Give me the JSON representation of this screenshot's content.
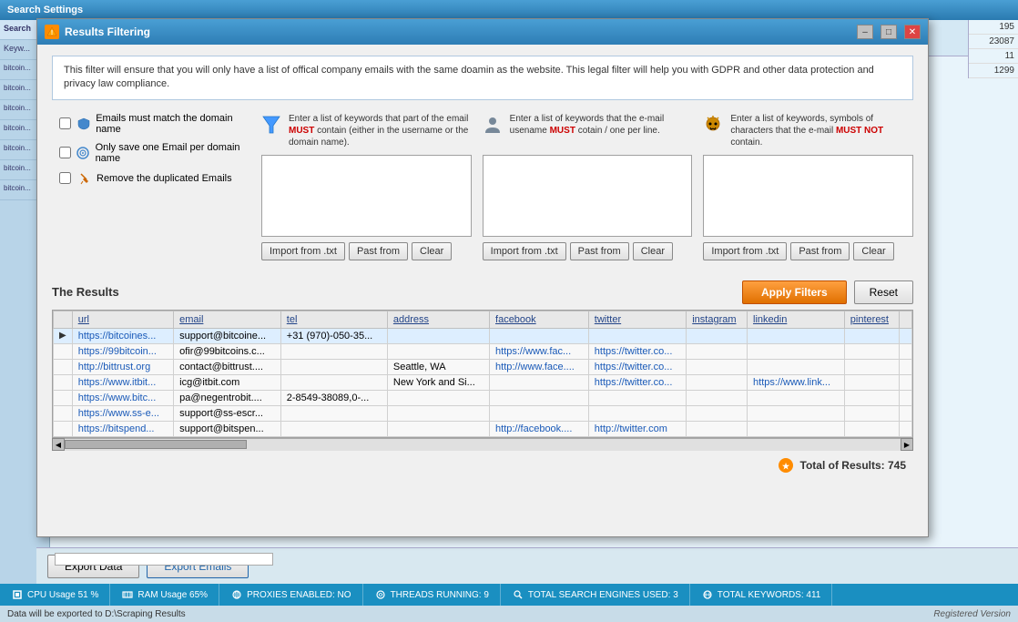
{
  "app": {
    "title": "Search Settings",
    "bg_title": "Search Settings"
  },
  "modal": {
    "title": "Results Filtering",
    "info_text": "This filter will ensure that you will only have a list of offical company emails with the same doamin as the website.  This legal filter will help you with GDPR and other data protection and privacy law compliance.",
    "checkboxes": [
      {
        "id": "cb1",
        "label": "Emails must match the domain name",
        "checked": false
      },
      {
        "id": "cb2",
        "label": "Only save one Email per domain name",
        "checked": false
      },
      {
        "id": "cb3",
        "label": "Remove the duplicated Emails",
        "checked": false
      }
    ],
    "filter_must_contain": {
      "header": "Enter a list of keywords that part of the email MUST contain (either in the username or the domain name).",
      "must_word": "MUST",
      "placeholder": "",
      "buttons": {
        "import": "Import from .txt",
        "paste": "Past from",
        "clear": "Clear"
      }
    },
    "filter_username_must": {
      "header": "Enter a list of keywords that the e-mail usename MUST cotain / one per line.",
      "must_word": "MUST",
      "placeholder": "",
      "buttons": {
        "import": "Import from .txt",
        "paste": "Past from",
        "clear": "Clear"
      }
    },
    "filter_must_not": {
      "header": "Enter a list of keywords, symbols of characters that the e-mail MUST NOT contain.",
      "must_word": "MUST NOT",
      "placeholder": "",
      "buttons": {
        "import": "Import from .txt",
        "paste": "Past from",
        "clear": "Clear"
      }
    },
    "results": {
      "title": "The Results",
      "apply_btn": "Apply Filters",
      "reset_btn": "Reset",
      "total_label": "Total of Results: 745"
    }
  },
  "table": {
    "columns": [
      "",
      "url",
      "email",
      "tel",
      "address",
      "facebook",
      "twitter",
      "instagram",
      "linkedin",
      "pinterest"
    ],
    "rows": [
      {
        "arrow": "▶",
        "url": "https://bitcoines...",
        "email": "support@bitcoine...",
        "tel": "+31 (970)-050-35...",
        "address": "",
        "facebook": "",
        "twitter": "",
        "instagram": "",
        "linkedin": "",
        "pinterest": ""
      },
      {
        "arrow": "",
        "url": "https://99bitcoin...",
        "email": "ofir@99bitcoins.c...",
        "tel": "",
        "address": "",
        "facebook": "https://www.fac...",
        "twitter": "https://twitter.co...",
        "instagram": "",
        "linkedin": "",
        "pinterest": ""
      },
      {
        "arrow": "",
        "url": "http://bittrust.org",
        "email": "contact@bittrust....",
        "tel": "",
        "address": "Seattle, WA",
        "facebook": "http://www.face....",
        "twitter": "https://twitter.co...",
        "instagram": "",
        "linkedin": "",
        "pinterest": ""
      },
      {
        "arrow": "",
        "url": "https://www.itbit...",
        "email": "icg@itbit.com",
        "tel": "",
        "address": "New York and Si...",
        "facebook": "",
        "twitter": "https://twitter.co...",
        "instagram": "",
        "linkedin": "https://www.link...",
        "pinterest": ""
      },
      {
        "arrow": "",
        "url": "https://www.bitc...",
        "email": "pa@negentrobit....",
        "tel": "2-8549-38089.0-...",
        "address": "",
        "facebook": "",
        "twitter": "",
        "instagram": "",
        "linkedin": "",
        "pinterest": ""
      },
      {
        "arrow": "",
        "url": "https://www.ss-e...",
        "email": "support@ss-escr...",
        "tel": "",
        "address": "",
        "facebook": "",
        "twitter": "",
        "instagram": "",
        "linkedin": "",
        "pinterest": ""
      },
      {
        "arrow": "",
        "url": "https://bitspend...",
        "email": "support@bitspen...",
        "tel": "",
        "address": "",
        "facebook": "http://facebook....",
        "twitter": "http://twitter.com",
        "instagram": "",
        "linkedin": "",
        "pinterest": ""
      }
    ]
  },
  "footer": {
    "export_data": "Export Data",
    "export_emails": "Export Emails",
    "export_path": "Data will be exported to D:\\Scraping Results",
    "registered": "Registered Version"
  },
  "status_bar": {
    "cpu": "CPU Usage 51 %",
    "ram": "RAM Usage 65%",
    "proxies": "PROXIES ENABLED: NO",
    "threads": "THREADS RUNNING: 9",
    "search_engines": "TOTAL SEARCH ENGINES USED: 3",
    "keywords": "TOTAL KEYWORDS: 411"
  },
  "bg_sidebar": {
    "items": [
      "bitcoin...",
      "bitcoin...",
      "bitcoin...",
      "bitcoin...",
      "bitcoin...",
      "bitcoin...",
      "bitcoin..."
    ]
  },
  "bg_right_numbers": [
    "195",
    "23087",
    "11",
    "1299"
  ]
}
